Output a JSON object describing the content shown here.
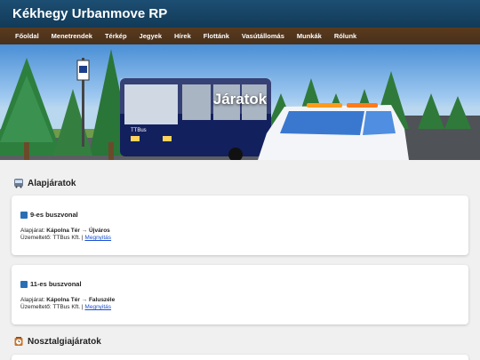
{
  "header": {
    "title": "Kékhegy Urbanmove RP"
  },
  "nav": {
    "items": [
      "Főoldal",
      "Menetrendek",
      "Térkép",
      "Jegyek",
      "Hírek",
      "Flottánk",
      "Vasútállomás",
      "Munkák",
      "Rólunk"
    ]
  },
  "hero": {
    "title": "Járatok",
    "bus_label": "TTBus"
  },
  "sections": {
    "alap": {
      "title": "Alapjáratok",
      "icon": "bus-icon",
      "cards": [
        {
          "line": "9-es buszvonal",
          "route_label": "Alapjárat:",
          "route": "Kápolna Tér → Újváros",
          "operator_label": "Üzemeltető:",
          "operator": "TTBus Kft.",
          "separator": "|",
          "link": "Megnyitás"
        },
        {
          "line": "11-es buszvonal",
          "route_label": "Alapjárat:",
          "route": "Kápolna Tér → Faluszéle",
          "operator_label": "Üzemeltető:",
          "operator": "TTBus Kft.",
          "separator": "|",
          "link": "Megnyitás"
        }
      ]
    },
    "nosztalgia": {
      "title": "Nosztalgiajáratok",
      "icon": "clock-icon"
    }
  },
  "colors": {
    "header": "#1c4e73",
    "nav": "#5a3a1e",
    "accent": "#2a6fb5",
    "link": "#1a4fd0"
  }
}
